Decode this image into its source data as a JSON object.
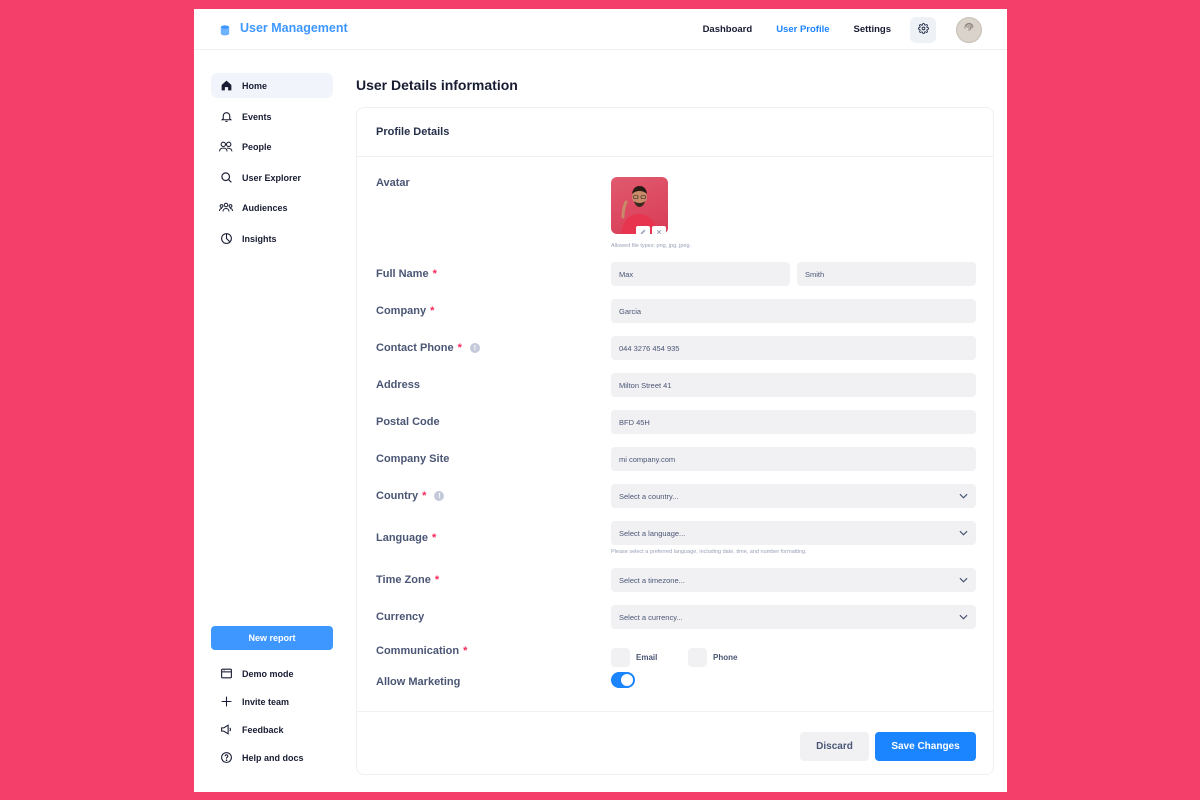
{
  "header": {
    "title": "User Management",
    "nav": [
      "Dashboard",
      "User Profile",
      "Settings"
    ],
    "active_nav": "User Profile"
  },
  "sidebar": {
    "items": [
      {
        "label": "Home",
        "icon": "home-icon",
        "active": true
      },
      {
        "label": "Events",
        "icon": "bell-icon"
      },
      {
        "label": "People",
        "icon": "people-icon"
      },
      {
        "label": "User Explorer",
        "icon": "search-icon"
      },
      {
        "label": "Audiences",
        "icon": "audiences-icon"
      },
      {
        "label": "Insights",
        "icon": "pie-chart-icon"
      }
    ],
    "new_report_label": "New report",
    "bottom_items": [
      {
        "label": "Demo mode",
        "icon": "window-icon"
      },
      {
        "label": "Invite team",
        "icon": "plus-icon"
      },
      {
        "label": "Feedback",
        "icon": "megaphone-icon"
      },
      {
        "label": "Help and docs",
        "icon": "question-icon"
      }
    ]
  },
  "main": {
    "page_title": "User Details information",
    "card_title": "Profile Details",
    "avatar": {
      "label": "Avatar",
      "hint": "Allowed file types: png, jpg, jpeg."
    },
    "full_name": {
      "label": "Full Name",
      "first": "Max",
      "last": "Smith"
    },
    "company": {
      "label": "Company",
      "value": "Garcia"
    },
    "contact_phone": {
      "label": "Contact Phone",
      "value": "044 3276 454 935"
    },
    "address": {
      "label": "Address",
      "value": "Milton Street 41"
    },
    "postal_code": {
      "label": "Postal Code",
      "value": "BFD 45H"
    },
    "company_site": {
      "label": "Company Site",
      "value": "mi company.com"
    },
    "country": {
      "label": "Country",
      "placeholder": "Select a country..."
    },
    "language": {
      "label": "Language",
      "placeholder": "Select a language...",
      "hint": "Please select a preferred language, including date, time, and number formatting."
    },
    "time_zone": {
      "label": "Time Zone",
      "placeholder": "Select a timezone..."
    },
    "currency": {
      "label": "Currency",
      "placeholder": "Select a currency..."
    },
    "communication": {
      "label": "Communication",
      "options": [
        "Email",
        "Phone"
      ]
    },
    "allow_marketing": {
      "label": "Allow Marketing",
      "enabled": true
    },
    "discard_label": "Discard",
    "save_label": "Save Changes"
  },
  "colors": {
    "background": "#f43f6a",
    "accent": "#1b84ff",
    "required": "#f8285a"
  }
}
